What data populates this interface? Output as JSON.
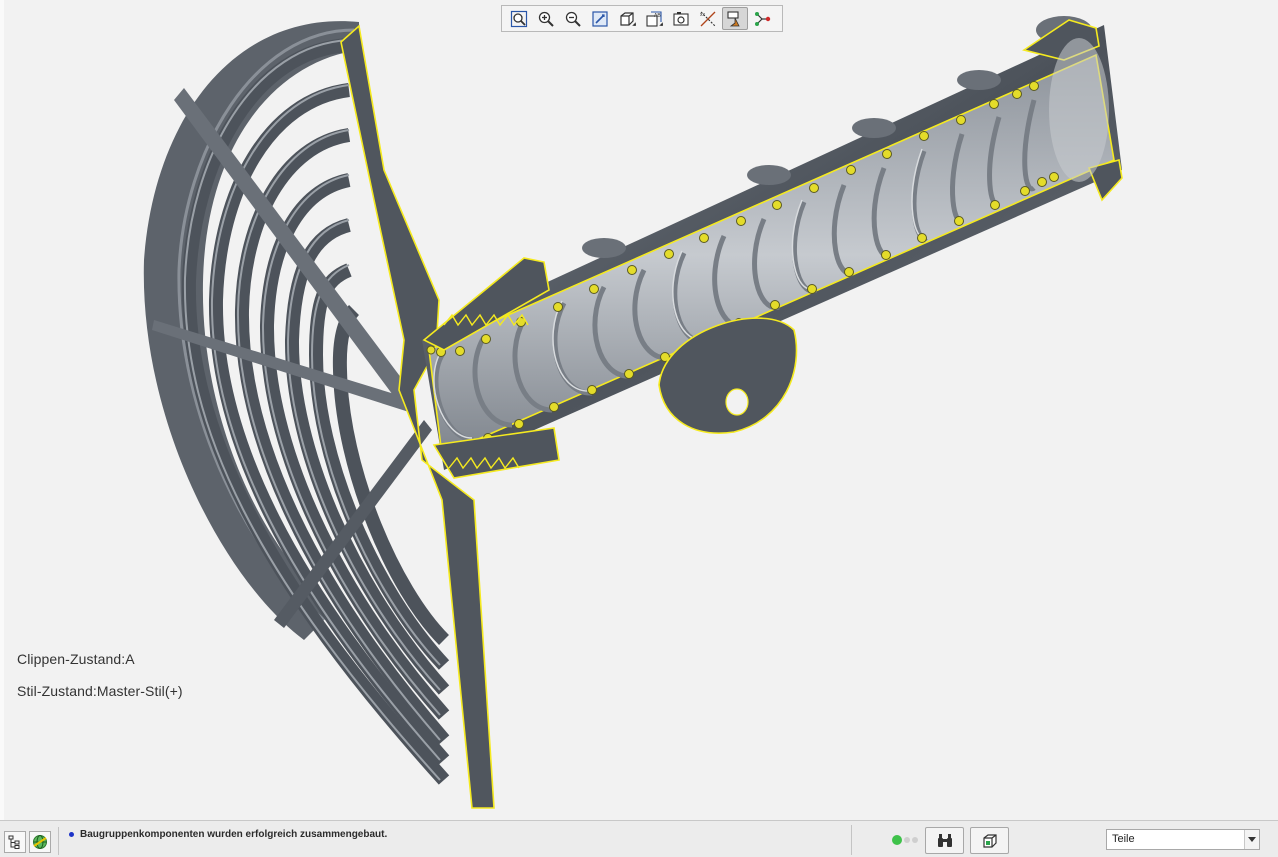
{
  "viewport": {
    "overlay": {
      "clip_state": "Clippen-Zustand:A",
      "style_state": "Stil-Zustand:Master-Stil(+)"
    },
    "section_edge_color": "#f5ea1f",
    "model_color": "#5a6068"
  },
  "toolbar": {
    "buttons": [
      {
        "icon": "zoom-fit-icon"
      },
      {
        "icon": "zoom-in-icon"
      },
      {
        "icon": "zoom-out-icon"
      },
      {
        "icon": "repaint-icon"
      },
      {
        "icon": "display-style-icon"
      },
      {
        "icon": "saved-views-icon"
      },
      {
        "icon": "view-manager-icon"
      },
      {
        "icon": "datum-display-icon"
      },
      {
        "icon": "annotation-display-icon",
        "active": true
      },
      {
        "icon": "spin-center-icon"
      }
    ]
  },
  "statusbar": {
    "message": "Baugruppenkomponenten wurden erfolgreich zusammengebaut.",
    "message_bullet_color": "#1d34c8",
    "filter": {
      "selected": "Teile"
    }
  }
}
